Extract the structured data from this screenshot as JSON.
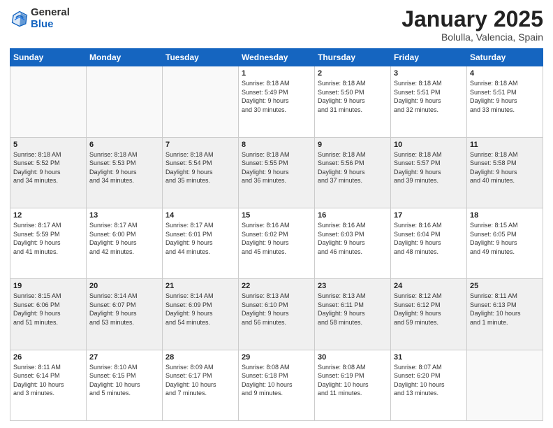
{
  "logo": {
    "general": "General",
    "blue": "Blue"
  },
  "title": "January 2025",
  "location": "Bolulla, Valencia, Spain",
  "days_header": [
    "Sunday",
    "Monday",
    "Tuesday",
    "Wednesday",
    "Thursday",
    "Friday",
    "Saturday"
  ],
  "weeks": [
    [
      {
        "day": "",
        "info": ""
      },
      {
        "day": "",
        "info": ""
      },
      {
        "day": "",
        "info": ""
      },
      {
        "day": "1",
        "info": "Sunrise: 8:18 AM\nSunset: 5:49 PM\nDaylight: 9 hours\nand 30 minutes."
      },
      {
        "day": "2",
        "info": "Sunrise: 8:18 AM\nSunset: 5:50 PM\nDaylight: 9 hours\nand 31 minutes."
      },
      {
        "day": "3",
        "info": "Sunrise: 8:18 AM\nSunset: 5:51 PM\nDaylight: 9 hours\nand 32 minutes."
      },
      {
        "day": "4",
        "info": "Sunrise: 8:18 AM\nSunset: 5:51 PM\nDaylight: 9 hours\nand 33 minutes."
      }
    ],
    [
      {
        "day": "5",
        "info": "Sunrise: 8:18 AM\nSunset: 5:52 PM\nDaylight: 9 hours\nand 34 minutes."
      },
      {
        "day": "6",
        "info": "Sunrise: 8:18 AM\nSunset: 5:53 PM\nDaylight: 9 hours\nand 34 minutes."
      },
      {
        "day": "7",
        "info": "Sunrise: 8:18 AM\nSunset: 5:54 PM\nDaylight: 9 hours\nand 35 minutes."
      },
      {
        "day": "8",
        "info": "Sunrise: 8:18 AM\nSunset: 5:55 PM\nDaylight: 9 hours\nand 36 minutes."
      },
      {
        "day": "9",
        "info": "Sunrise: 8:18 AM\nSunset: 5:56 PM\nDaylight: 9 hours\nand 37 minutes."
      },
      {
        "day": "10",
        "info": "Sunrise: 8:18 AM\nSunset: 5:57 PM\nDaylight: 9 hours\nand 39 minutes."
      },
      {
        "day": "11",
        "info": "Sunrise: 8:18 AM\nSunset: 5:58 PM\nDaylight: 9 hours\nand 40 minutes."
      }
    ],
    [
      {
        "day": "12",
        "info": "Sunrise: 8:17 AM\nSunset: 5:59 PM\nDaylight: 9 hours\nand 41 minutes."
      },
      {
        "day": "13",
        "info": "Sunrise: 8:17 AM\nSunset: 6:00 PM\nDaylight: 9 hours\nand 42 minutes."
      },
      {
        "day": "14",
        "info": "Sunrise: 8:17 AM\nSunset: 6:01 PM\nDaylight: 9 hours\nand 44 minutes."
      },
      {
        "day": "15",
        "info": "Sunrise: 8:16 AM\nSunset: 6:02 PM\nDaylight: 9 hours\nand 45 minutes."
      },
      {
        "day": "16",
        "info": "Sunrise: 8:16 AM\nSunset: 6:03 PM\nDaylight: 9 hours\nand 46 minutes."
      },
      {
        "day": "17",
        "info": "Sunrise: 8:16 AM\nSunset: 6:04 PM\nDaylight: 9 hours\nand 48 minutes."
      },
      {
        "day": "18",
        "info": "Sunrise: 8:15 AM\nSunset: 6:05 PM\nDaylight: 9 hours\nand 49 minutes."
      }
    ],
    [
      {
        "day": "19",
        "info": "Sunrise: 8:15 AM\nSunset: 6:06 PM\nDaylight: 9 hours\nand 51 minutes."
      },
      {
        "day": "20",
        "info": "Sunrise: 8:14 AM\nSunset: 6:07 PM\nDaylight: 9 hours\nand 53 minutes."
      },
      {
        "day": "21",
        "info": "Sunrise: 8:14 AM\nSunset: 6:09 PM\nDaylight: 9 hours\nand 54 minutes."
      },
      {
        "day": "22",
        "info": "Sunrise: 8:13 AM\nSunset: 6:10 PM\nDaylight: 9 hours\nand 56 minutes."
      },
      {
        "day": "23",
        "info": "Sunrise: 8:13 AM\nSunset: 6:11 PM\nDaylight: 9 hours\nand 58 minutes."
      },
      {
        "day": "24",
        "info": "Sunrise: 8:12 AM\nSunset: 6:12 PM\nDaylight: 9 hours\nand 59 minutes."
      },
      {
        "day": "25",
        "info": "Sunrise: 8:11 AM\nSunset: 6:13 PM\nDaylight: 10 hours\nand 1 minute."
      }
    ],
    [
      {
        "day": "26",
        "info": "Sunrise: 8:11 AM\nSunset: 6:14 PM\nDaylight: 10 hours\nand 3 minutes."
      },
      {
        "day": "27",
        "info": "Sunrise: 8:10 AM\nSunset: 6:15 PM\nDaylight: 10 hours\nand 5 minutes."
      },
      {
        "day": "28",
        "info": "Sunrise: 8:09 AM\nSunset: 6:17 PM\nDaylight: 10 hours\nand 7 minutes."
      },
      {
        "day": "29",
        "info": "Sunrise: 8:08 AM\nSunset: 6:18 PM\nDaylight: 10 hours\nand 9 minutes."
      },
      {
        "day": "30",
        "info": "Sunrise: 8:08 AM\nSunset: 6:19 PM\nDaylight: 10 hours\nand 11 minutes."
      },
      {
        "day": "31",
        "info": "Sunrise: 8:07 AM\nSunset: 6:20 PM\nDaylight: 10 hours\nand 13 minutes."
      },
      {
        "day": "",
        "info": ""
      }
    ]
  ]
}
